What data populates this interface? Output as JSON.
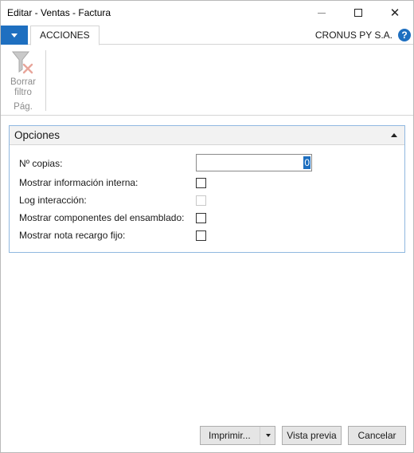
{
  "window": {
    "title": "Editar - Ventas - Factura"
  },
  "ribbon": {
    "tabs": [
      "ACCIONES"
    ],
    "company": "CRONUS PY S.A.",
    "clear_filter": {
      "label_line1": "Borrar",
      "label_line2": "filtro",
      "icon": "clear-filter-icon",
      "enabled": false
    },
    "group_label": "Pág."
  },
  "options": {
    "title": "Opciones",
    "copies_label": "Nº copias:",
    "copies_value": "0",
    "fields": [
      {
        "label": "Mostrar información interna:",
        "checked": false,
        "enabled": true
      },
      {
        "label": "Log interacción:",
        "checked": false,
        "enabled": false
      },
      {
        "label": "Mostrar componentes del ensamblado:",
        "checked": false,
        "enabled": true
      },
      {
        "label": "Mostrar nota recargo fijo:",
        "checked": false,
        "enabled": true
      }
    ]
  },
  "footer": {
    "print_label": "Imprimir...",
    "preview_label": "Vista previa",
    "cancel_label": "Cancelar"
  },
  "colors": {
    "accent": "#1e6fc0",
    "panel_border": "#90b8e0",
    "disabled_text": "#8c8c8c"
  }
}
